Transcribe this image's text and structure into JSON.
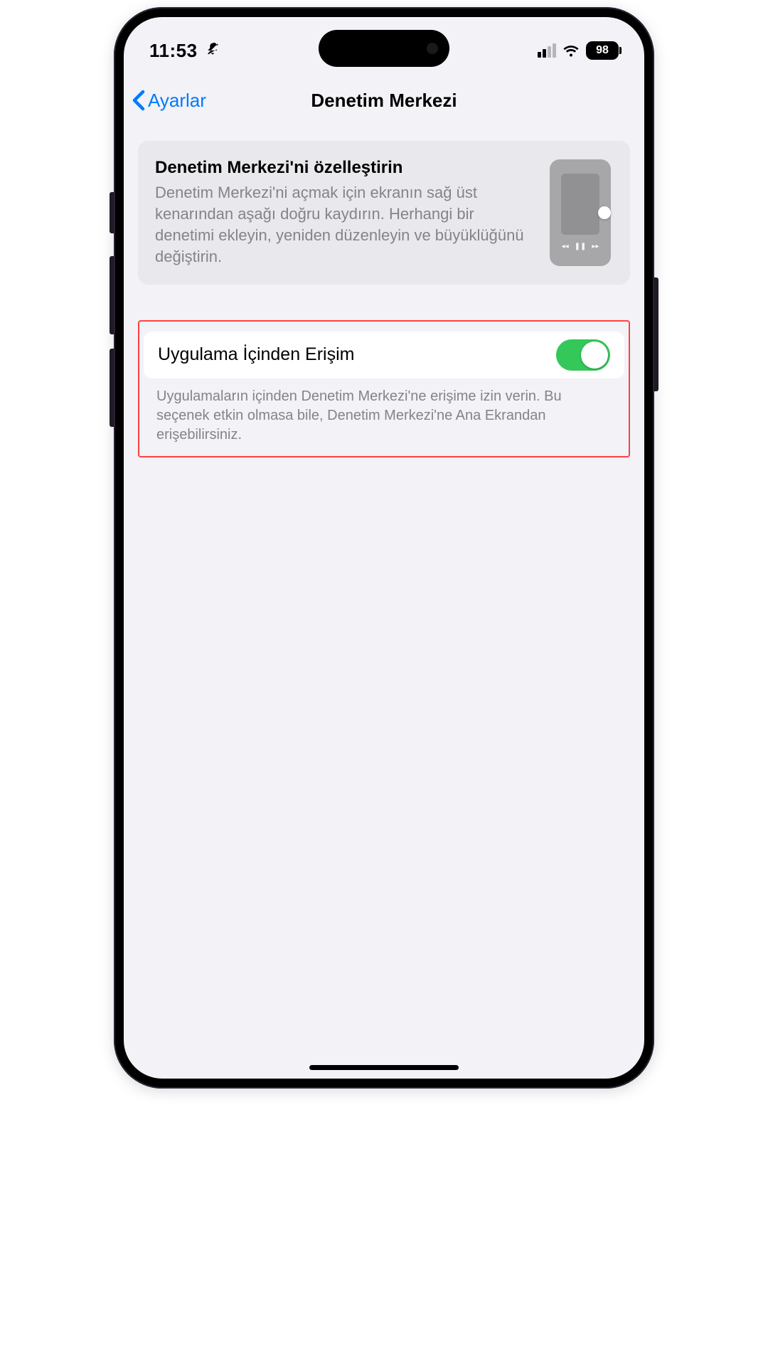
{
  "status": {
    "time": "11:53",
    "battery": "98"
  },
  "nav": {
    "back_label": "Ayarlar",
    "title": "Denetim Merkezi"
  },
  "hero": {
    "title": "Denetim Merkezi'ni özelleştirin",
    "subtitle": "Denetim Merkezi'ni açmak için ekranın sağ üst kenarından aşağı doğru kaydırın. Herhangi bir denetimi ekleyin, yeniden düzenleyin ve büyüklüğünü değiştirin."
  },
  "setting": {
    "label": "Uygulama İçinden Erişim",
    "enabled": true,
    "footer": "Uygulamaların içinden Denetim Merkezi'ne erişime izin verin. Bu seçenek etkin olmasa bile, Denetim Merkezi'ne Ana Ekrandan erişebilirsiniz."
  }
}
